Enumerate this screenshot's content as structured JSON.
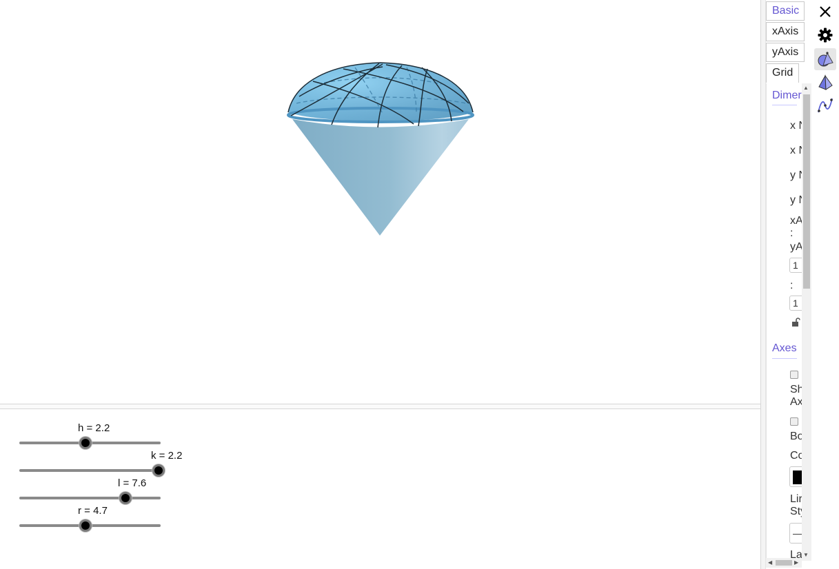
{
  "sliders": [
    {
      "label": "h = 2.2",
      "value": 2.2
    },
    {
      "label": "k = 2.2",
      "value": 2.2
    },
    {
      "label": "l = 7.6",
      "value": 7.6
    },
    {
      "label": "r = 4.7",
      "value": 4.7
    }
  ],
  "properties": {
    "tabs": [
      "Basic",
      "xAxis",
      "yAxis",
      "Grid"
    ],
    "active_tab": "Basic",
    "sections": {
      "dimensions": "Dimer",
      "axes": "Axes"
    },
    "dimension_rows": [
      "x N",
      "x N",
      "y N",
      "y N"
    ],
    "ratio_label_1": "xA",
    "ratio_colon": ":",
    "ratio_label_2": "yA",
    "ratio_value_1": "1",
    "ratio_value_2": "1",
    "show_axes_label_1": "Sh",
    "show_axes_label_2": "Ax",
    "bold_label": "Bo",
    "color_label": "Co",
    "line_style_label_1": "Lir",
    "line_style_label_2": "Sty",
    "line_style_value": "—",
    "label_cut": "La"
  },
  "colors": {
    "accent": "#6557d2",
    "surface": "#87bedd",
    "cone": "#91b8cd"
  },
  "icons": {
    "close": "close-icon",
    "settings": "gear-icon",
    "graphics3d": "graphics-3d-style-icon",
    "pyramid": "pyramid-icon",
    "graphics2d": "graphics-style-icon"
  }
}
